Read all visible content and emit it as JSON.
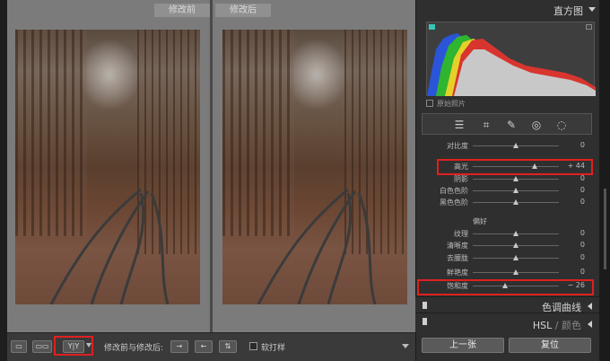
{
  "view": {
    "before_label": "修改前",
    "after_label": "修改后"
  },
  "toolbar": {
    "loupe_icon": "single-view-icon",
    "compare_icon": "side-by-side-icon",
    "yy_label": "Y|Y",
    "compare_label": "修改前与修改后:",
    "soft_proof_label": "软打样"
  },
  "histogram": {
    "title": "直方图",
    "original_photo_label": "原始照片"
  },
  "adjustments": {
    "rows_top": [
      {
        "label": "对比度",
        "value": "0",
        "level": 0
      },
      {
        "label": "高光",
        "value": "+ 44",
        "level": 0.44
      },
      {
        "label": "阴影",
        "value": "0",
        "level": 0
      },
      {
        "label": "白色色阶",
        "value": "0",
        "level": 0
      },
      {
        "label": "黑色色阶",
        "value": "0",
        "level": 0
      }
    ],
    "presence_title": "偏好",
    "rows_presence": [
      {
        "label": "纹理",
        "value": "0",
        "level": 0
      },
      {
        "label": "清晰度",
        "value": "0",
        "level": 0
      },
      {
        "label": "去朦胧",
        "value": "0",
        "level": 0
      },
      {
        "label": "鲜艳度",
        "value": "0",
        "level": 0
      },
      {
        "label": "饱和度",
        "value": "− 26",
        "level": -0.26
      }
    ]
  },
  "sections": {
    "tone_curve": "色调曲线",
    "hsl": "HSL",
    "hsl_sep": "/",
    "color": "颜色"
  },
  "buttons": {
    "previous": "上一张",
    "reset": "复位"
  },
  "colors": {
    "highlight_box": "#e02020"
  }
}
